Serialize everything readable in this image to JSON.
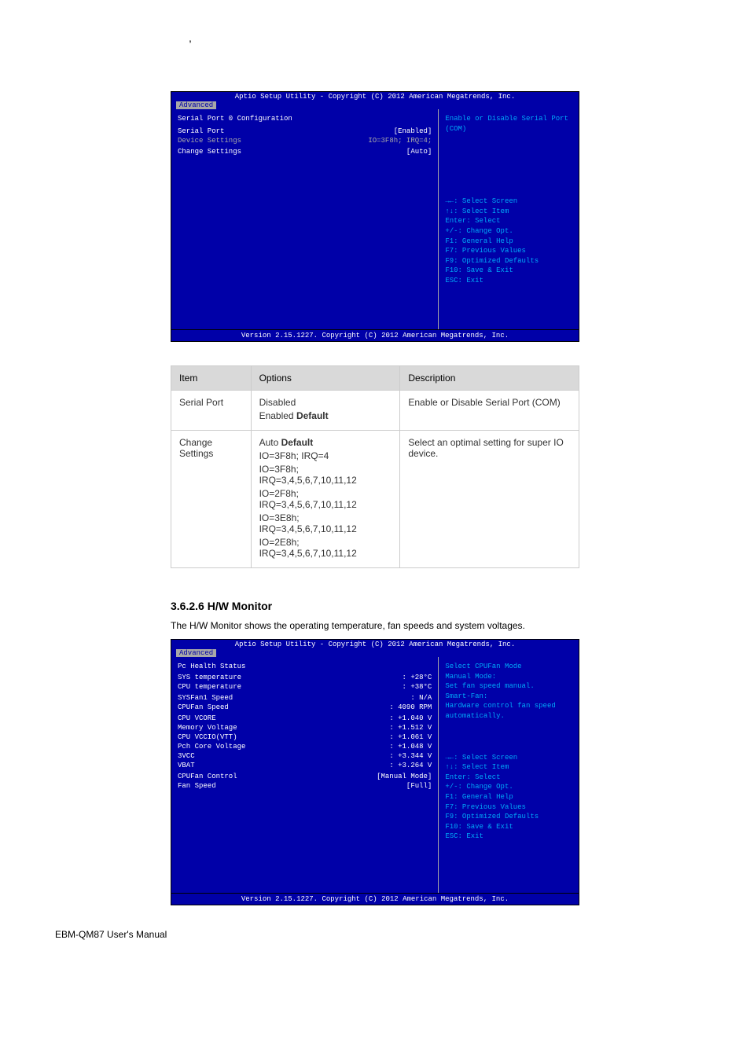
{
  "comma": ",",
  "bios1": {
    "header": "Aptio Setup Utility - Copyright (C) 2012 American Megatrends, Inc.",
    "tab": "Advanced",
    "title": "Serial Port 0 Configuration",
    "rows": [
      {
        "label": "Serial Port",
        "value": "[Enabled]",
        "cls": "bios-selected"
      },
      {
        "label": "Device Settings",
        "value": "IO=3F8h; IRQ=4;",
        "cls": "bios-gray"
      },
      {
        "label": "",
        "value": ""
      },
      {
        "label": "Change Settings",
        "value": "[Auto]",
        "cls": "bios-selected"
      }
    ],
    "help": "Enable or Disable Serial Port (COM)",
    "nav": [
      "→←: Select Screen",
      "↑↓: Select Item",
      "Enter: Select",
      "+/-: Change Opt.",
      "F1: General Help",
      "F7: Previous Values",
      "F9: Optimized Defaults",
      "F10: Save & Exit",
      "ESC: Exit"
    ],
    "footer": "Version 2.15.1227. Copyright (C) 2012 American Megatrends, Inc."
  },
  "table": {
    "headers": [
      "Item",
      "Options",
      "Description"
    ],
    "rows": [
      {
        "item": "Serial Port",
        "options": [
          "Disabled",
          "Enabled  Default"
        ],
        "desc": "Enable or Disable Serial Port (COM)"
      },
      {
        "item": "Change Settings",
        "options": [
          "Auto  Default",
          "IO=3F8h; IRQ=4",
          "IO=3F8h; IRQ=3,4,5,6,7,10,11,12",
          "IO=2F8h; IRQ=3,4,5,6,7,10,11,12",
          "IO=3E8h; IRQ=3,4,5,6,7,10,11,12",
          "IO=2E8h; IRQ=3,4,5,6,7,10,11,12"
        ],
        "desc": "Select an optimal setting for super IO device."
      }
    ]
  },
  "section": {
    "title": "3.6.2.6 H/W Monitor",
    "desc": "The H/W Monitor shows the operating temperature, fan speeds and system voltages."
  },
  "bios2": {
    "header": "Aptio Setup Utility - Copyright (C) 2012 American Megatrends, Inc.",
    "tab": "Advanced",
    "title": "Pc Health Status",
    "rows": [
      {
        "label": "",
        "value": ""
      },
      {
        "label": "SYS temperature",
        "value": ": +28°C"
      },
      {
        "label": "CPU temperature",
        "value": ": +38°C"
      },
      {
        "label": "",
        "value": ""
      },
      {
        "label": "SYSFan1 Speed",
        "value": ": N/A"
      },
      {
        "label": "CPUFan  Speed",
        "value": ": 4090 RPM"
      },
      {
        "label": "",
        "value": ""
      },
      {
        "label": "CPU VCORE",
        "value": ": +1.040 V"
      },
      {
        "label": "Memory  Voltage",
        "value": ": +1.512 V"
      },
      {
        "label": "CPU  VCCIO(VTT)",
        "value": ": +1.061 V"
      },
      {
        "label": "Pch Core Voltage",
        "value": ": +1.048 V"
      },
      {
        "label": "3VCC",
        "value": ": +3.344 V"
      },
      {
        "label": "VBAT",
        "value": ": +3.264 V"
      },
      {
        "label": "",
        "value": ""
      },
      {
        "label": "CPUFan Control",
        "value": "[Manual Mode]",
        "cls": "bios-selected"
      },
      {
        "label": "Fan Speed",
        "value": "[Full]",
        "cls": "bios-selected"
      }
    ],
    "help": "Select CPUFan Mode\nManual Mode:\nSet fan speed manual.\nSmart-Fan:\nHardware control fan speed automatically.",
    "nav": [
      "→←: Select Screen",
      "↑↓: Select Item",
      "Enter: Select",
      "+/-: Change Opt.",
      "F1: General Help",
      "F7: Previous Values",
      "F9: Optimized Defaults",
      "F10: Save & Exit",
      "ESC: Exit"
    ],
    "footer": "Version 2.15.1227. Copyright (C) 2012 American Megatrends, Inc."
  },
  "footer": "EBM-QM87 User's Manual"
}
